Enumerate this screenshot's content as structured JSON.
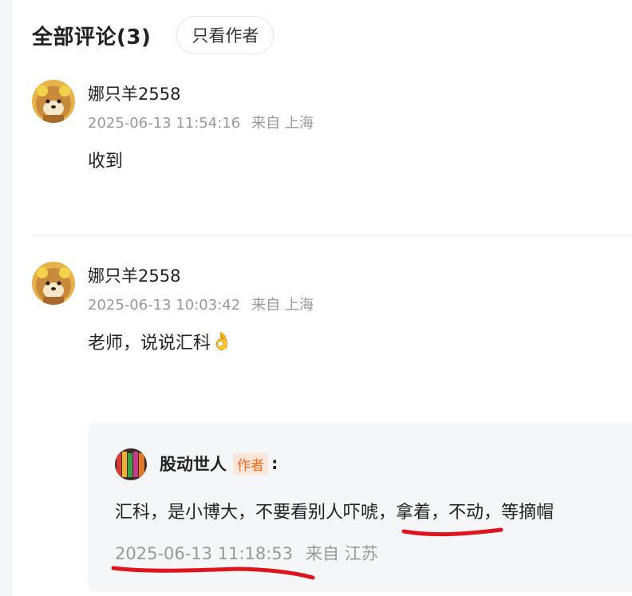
{
  "header": {
    "title": "全部评论(3)",
    "filter_button": "只看作者"
  },
  "comments": [
    {
      "username": "娜只羊2558",
      "timestamp": "2025-06-13 11:54:16",
      "location": "来自 上海",
      "text": "收到",
      "avatar_icon": "shiba-plush-avatar-icon"
    },
    {
      "username": "娜只羊2558",
      "timestamp": "2025-06-13 10:03:42",
      "location": "来自 上海",
      "text": "老师，说说汇科",
      "emoji": "👌",
      "avatar_icon": "shiba-plush-avatar-icon"
    }
  ],
  "reply": {
    "username": "股动世人",
    "author_tag": "作者",
    "colon": ":",
    "text": "汇科，是小博大，不要看别人吓唬，拿着，不动，等摘帽",
    "timestamp": "2025-06-13 11:18:53",
    "location": "来自 江苏",
    "avatar_icon": "colorful-bottles-avatar-icon"
  },
  "colors": {
    "annotation_red": "#e0141e",
    "author_tag_text": "#ff6a1a",
    "author_tag_bg": "#fde6d9",
    "meta_gray": "#999999"
  }
}
